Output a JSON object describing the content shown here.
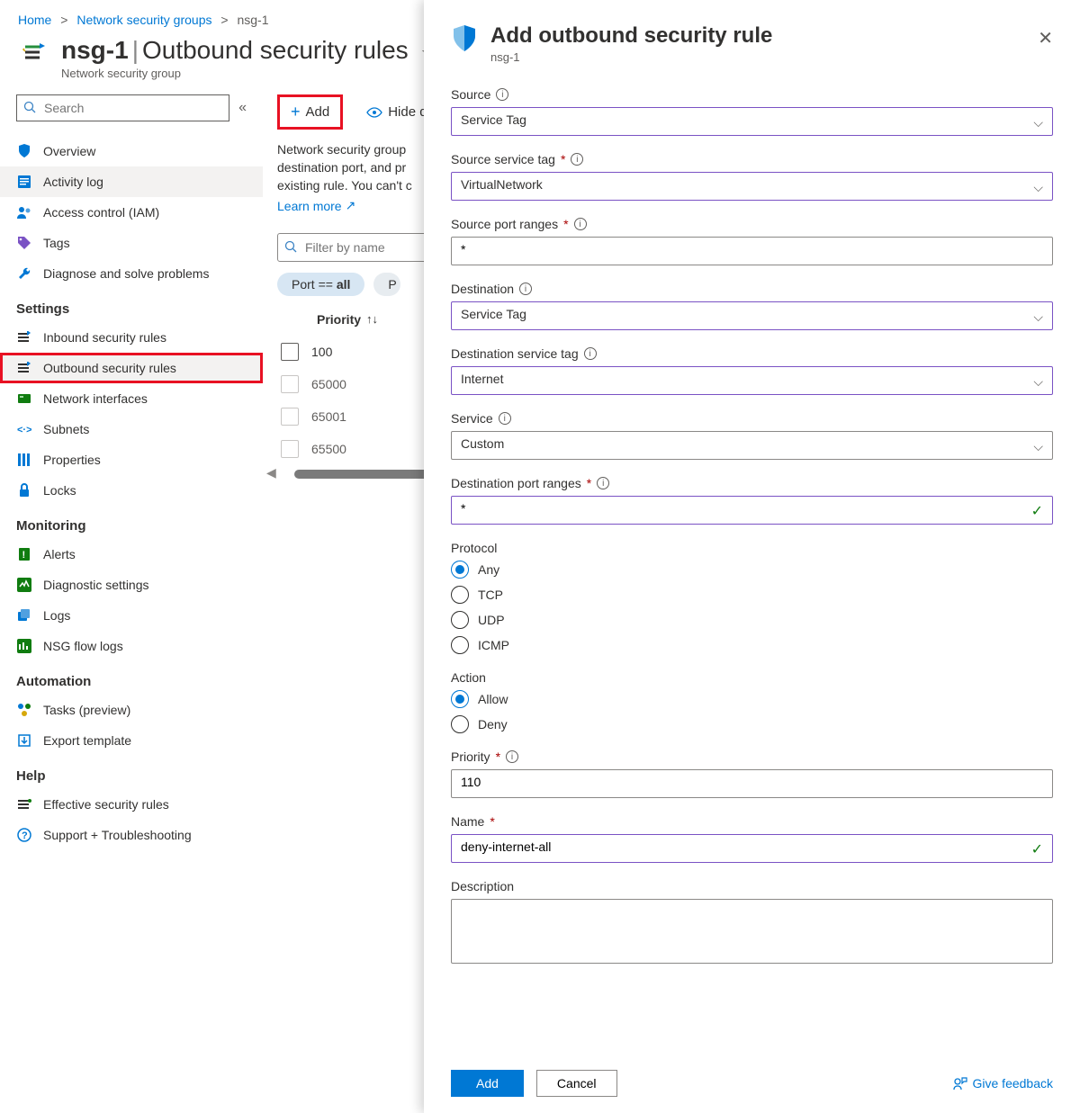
{
  "breadcrumb": {
    "home": "Home",
    "nsg_list": "Network security groups",
    "current": "nsg-1"
  },
  "header": {
    "name": "nsg-1",
    "section": "Outbound security rules",
    "subtitle": "Network security group"
  },
  "search": {
    "placeholder": "Search"
  },
  "sidebar": {
    "items_main": [
      {
        "label": "Overview"
      },
      {
        "label": "Activity log"
      },
      {
        "label": "Access control (IAM)"
      },
      {
        "label": "Tags"
      },
      {
        "label": "Diagnose and solve problems"
      }
    ],
    "group_settings": "Settings",
    "items_settings": [
      {
        "label": "Inbound security rules"
      },
      {
        "label": "Outbound security rules"
      },
      {
        "label": "Network interfaces"
      },
      {
        "label": "Subnets"
      },
      {
        "label": "Properties"
      },
      {
        "label": "Locks"
      }
    ],
    "group_monitoring": "Monitoring",
    "items_monitoring": [
      {
        "label": "Alerts"
      },
      {
        "label": "Diagnostic settings"
      },
      {
        "label": "Logs"
      },
      {
        "label": "NSG flow logs"
      }
    ],
    "group_automation": "Automation",
    "items_automation": [
      {
        "label": "Tasks (preview)"
      },
      {
        "label": "Export template"
      }
    ],
    "group_help": "Help",
    "items_help": [
      {
        "label": "Effective security rules"
      },
      {
        "label": "Support + Troubleshooting"
      }
    ]
  },
  "toolbar": {
    "add": "Add",
    "hide_default": "Hide de"
  },
  "description": {
    "line1": "Network security group",
    "line2": "destination port, and pr",
    "line3": "existing rule. You can't c",
    "learn_more": "Learn more"
  },
  "filter": {
    "placeholder": "Filter by name"
  },
  "pills": {
    "port_label": "Port == ",
    "port_value": "all",
    "partial": "P"
  },
  "columns": {
    "priority": "Priority"
  },
  "rows": [
    {
      "priority": "100",
      "default": false
    },
    {
      "priority": "65000",
      "default": true
    },
    {
      "priority": "65001",
      "default": true
    },
    {
      "priority": "65500",
      "default": true
    }
  ],
  "panel": {
    "title": "Add outbound security rule",
    "subtitle": "nsg-1",
    "labels": {
      "source": "Source",
      "source_service_tag": "Source service tag",
      "source_port_ranges": "Source port ranges",
      "destination": "Destination",
      "destination_service_tag": "Destination service tag",
      "service": "Service",
      "destination_port_ranges": "Destination port ranges",
      "protocol": "Protocol",
      "action": "Action",
      "priority": "Priority",
      "name": "Name",
      "description": "Description"
    },
    "values": {
      "source": "Service Tag",
      "source_service_tag": "VirtualNetwork",
      "source_port_ranges": "*",
      "destination": "Service Tag",
      "destination_service_tag": "Internet",
      "service": "Custom",
      "destination_port_ranges": "*",
      "priority": "110",
      "name": "deny-internet-all",
      "description": ""
    },
    "protocol_options": [
      "Any",
      "TCP",
      "UDP",
      "ICMP"
    ],
    "protocol_selected": "Any",
    "action_options": [
      "Allow",
      "Deny"
    ],
    "action_selected": "Allow",
    "buttons": {
      "add": "Add",
      "cancel": "Cancel",
      "feedback": "Give feedback"
    }
  }
}
